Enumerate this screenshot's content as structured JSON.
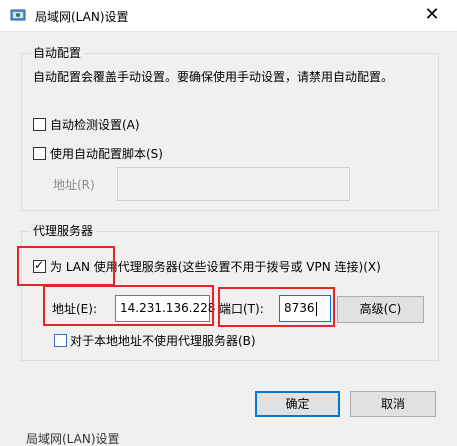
{
  "window": {
    "title": "局域网(LAN)设置",
    "close_glyph": "✕"
  },
  "auto_config": {
    "group_label": "自动配置",
    "description": "自动配置会覆盖手动设置。要确保使用手动设置，请禁用自动配置。",
    "auto_detect_label": "自动检测设置(A)",
    "auto_detect_checked": false,
    "use_script_label": "使用自动配置脚本(S)",
    "use_script_checked": false,
    "address_label": "地址(R)",
    "address_value": ""
  },
  "proxy": {
    "group_label": "代理服务器",
    "use_proxy_label": "为 LAN 使用代理服务器(这些设置不用于拨号或 VPN 连接)(X)",
    "use_proxy_checked": true,
    "address_label": "地址(E):",
    "address_value": "14.231.136.228",
    "port_label": "端口(T):",
    "port_value": "8736",
    "advanced_label": "高级(C)",
    "bypass_local_label": "对于本地地址不使用代理服务器(B)",
    "bypass_local_checked": false
  },
  "footer": {
    "ok_label": "确定",
    "cancel_label": "取消"
  },
  "colors": {
    "highlight_box": "#e8232a",
    "focus_border": "#0078d7"
  }
}
